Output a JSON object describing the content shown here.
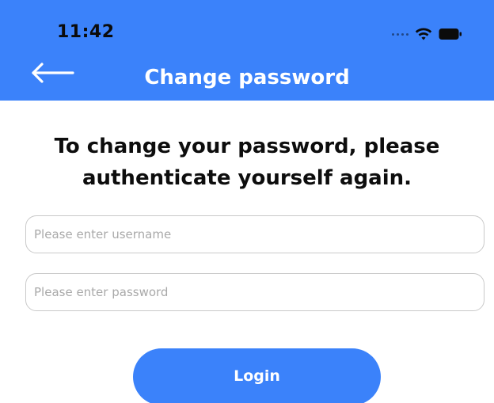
{
  "status_bar": {
    "time": "11:42",
    "icons": [
      "signal-dots-icon",
      "wifi-icon",
      "battery-icon"
    ]
  },
  "header": {
    "title": "Change password",
    "back_icon": "arrow-left-icon",
    "background_color": "#3B82FA",
    "title_color": "#FFFFFF"
  },
  "main": {
    "heading": "To change your password, please authenticate yourself again.",
    "username_placeholder": "Please enter username",
    "username_value": "",
    "password_placeholder": "Please enter password",
    "password_value": "",
    "login_label": "Login",
    "accent_color": "#3B82FA"
  }
}
